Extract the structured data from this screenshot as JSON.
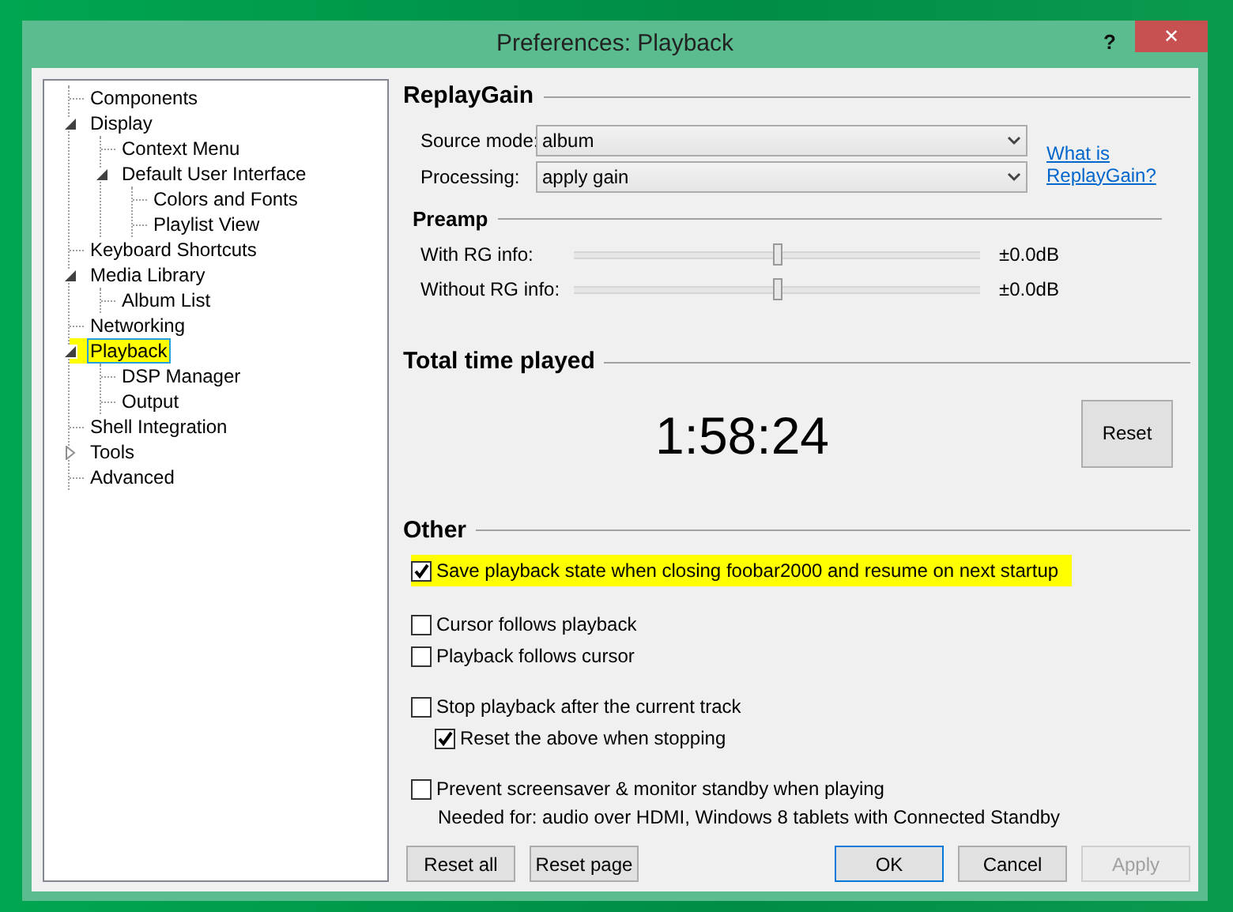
{
  "window": {
    "title": "Preferences: Playback",
    "help": "?",
    "close": "✕"
  },
  "tree": [
    {
      "label": "Components",
      "selected": false,
      "highlighted": false
    },
    {
      "label": "Display",
      "selected": false,
      "highlighted": false,
      "expanded": true,
      "children": [
        {
          "label": "Context Menu",
          "selected": false,
          "highlighted": false
        },
        {
          "label": "Default User Interface",
          "selected": false,
          "highlighted": false,
          "expanded": true,
          "children": [
            {
              "label": "Colors and Fonts",
              "selected": false,
              "highlighted": false
            },
            {
              "label": "Playlist View",
              "selected": false,
              "highlighted": false
            }
          ]
        }
      ]
    },
    {
      "label": "Keyboard Shortcuts",
      "selected": false,
      "highlighted": false
    },
    {
      "label": "Media Library",
      "selected": false,
      "highlighted": false,
      "expanded": true,
      "children": [
        {
          "label": "Album List",
          "selected": false,
          "highlighted": false
        }
      ]
    },
    {
      "label": "Networking",
      "selected": false,
      "highlighted": false
    },
    {
      "label": "Playback",
      "selected": true,
      "highlighted": true,
      "expanded": true,
      "children": [
        {
          "label": "DSP Manager",
          "selected": false,
          "highlighted": false
        },
        {
          "label": "Output",
          "selected": false,
          "highlighted": false
        }
      ]
    },
    {
      "label": "Shell Integration",
      "selected": false,
      "highlighted": false
    },
    {
      "label": "Tools",
      "selected": false,
      "highlighted": false,
      "expanded": false
    },
    {
      "label": "Advanced",
      "selected": false,
      "highlighted": false
    }
  ],
  "replaygain": {
    "title": "ReplayGain",
    "fields": [
      {
        "label": "Source mode:",
        "value": "album"
      },
      {
        "label": "Processing:",
        "value": "apply gain"
      }
    ],
    "link": "What is ReplayGain?",
    "preamp": {
      "title": "Preamp",
      "sliders": [
        {
          "label": "With RG info:",
          "level": 0.5,
          "reading": "±0.0dB"
        },
        {
          "label": "Without RG info:",
          "level": 0.5,
          "reading": "±0.0dB"
        }
      ]
    }
  },
  "total_time": {
    "title": "Total time played",
    "time": "1:58:24",
    "button": "Reset"
  },
  "other": {
    "title": "Other",
    "groups": [
      [
        {
          "label": "Save playback state when closing foobar2000 and resume on next startup",
          "checked": true,
          "highlighted": true
        }
      ],
      [
        {
          "label": "Cursor follows playback",
          "checked": false,
          "highlighted": false
        },
        {
          "label": "Playback follows cursor",
          "checked": false,
          "highlighted": false
        }
      ],
      [
        {
          "label": "Stop playback after the current track",
          "checked": false,
          "highlighted": false,
          "children": [
            {
              "label": "Reset the above when stopping",
              "checked": true,
              "highlighted": false
            }
          ]
        }
      ],
      [
        {
          "label": "Prevent screensaver & monitor standby when playing",
          "checked": false,
          "highlighted": false
        }
      ]
    ],
    "note": "Needed for: audio over HDMI, Windows 8 tablets with Connected Standby"
  },
  "buttons": [
    {
      "label": "Reset all",
      "kind": "normal",
      "disabled": false
    },
    {
      "label": "Reset page",
      "kind": "normal",
      "disabled": false
    },
    {
      "label": "OK",
      "kind": "default",
      "disabled": false
    },
    {
      "label": "Cancel",
      "kind": "normal",
      "disabled": false
    },
    {
      "label": "Apply",
      "kind": "normal",
      "disabled": true
    }
  ]
}
